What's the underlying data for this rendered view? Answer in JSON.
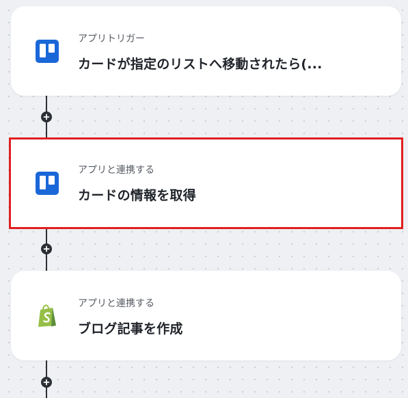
{
  "steps": [
    {
      "subtitle": "アプリトリガー",
      "title": "カードが指定のリストへ移動されたら(...",
      "icon": "trello-icon",
      "selected": false
    },
    {
      "subtitle": "アプリと連携する",
      "title": "カードの情報を取得",
      "icon": "trello-icon",
      "selected": true
    },
    {
      "subtitle": "アプリと連携する",
      "title": "ブログ記事を作成",
      "icon": "shopify-icon",
      "selected": false
    }
  ],
  "colors": {
    "trello": "#1a67d8",
    "shopify": "#95bf47",
    "selected_border": "#e01f1f",
    "connector": "#2c2f36"
  }
}
